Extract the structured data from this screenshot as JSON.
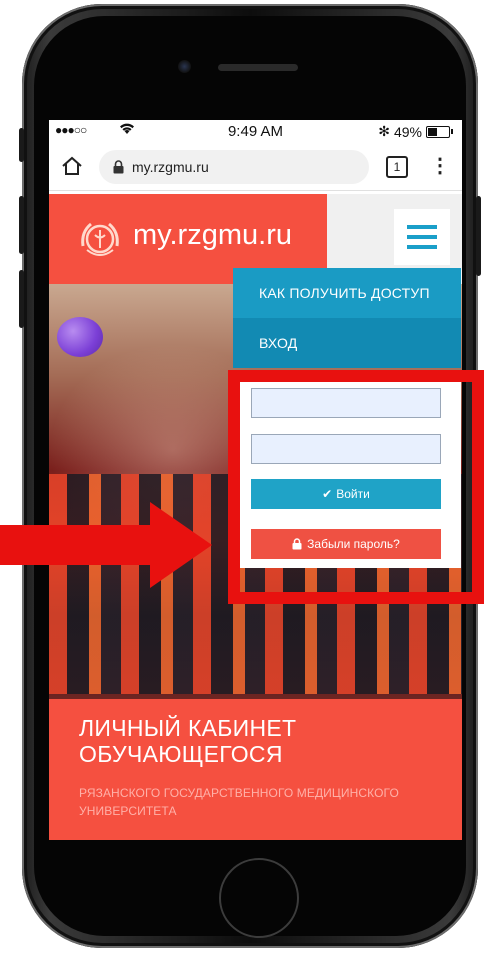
{
  "status_bar": {
    "signal": "●●●○○",
    "time": "9:49 AM",
    "bluetooth": "✻",
    "battery_percent": "49%",
    "battery_level": 0.49
  },
  "browser": {
    "url": "my.rzgmu.ru",
    "tab_count": "1",
    "menu_glyph": "⋮"
  },
  "site": {
    "logo_text": "my.rzgmu.ru"
  },
  "nav": {
    "items": [
      {
        "label": "КАК ПОЛУЧИТЬ ДОСТУП"
      },
      {
        "label": "ВХОД"
      }
    ]
  },
  "login_form": {
    "login_value": "",
    "password_value": "",
    "submit_label": "Войти",
    "forgot_label": "Забыли пароль?"
  },
  "footer": {
    "title_line1": "ЛИЧНЫЙ КАБИНЕТ",
    "title_line2": "ОБУЧАЮЩЕГОСЯ",
    "subtitle_line1": "РЯЗАНСКОГО ГОСУДАРСТВЕННОГО МЕДИЦИНСКОГО",
    "subtitle_line2": "УНИВЕРСИТЕТА"
  },
  "colors": {
    "brand_red": "#f55040",
    "nav_blue": "#1597c0",
    "button_blue": "#1fa3c7",
    "button_red": "#ef5143",
    "highlight_red": "#e8110f"
  }
}
